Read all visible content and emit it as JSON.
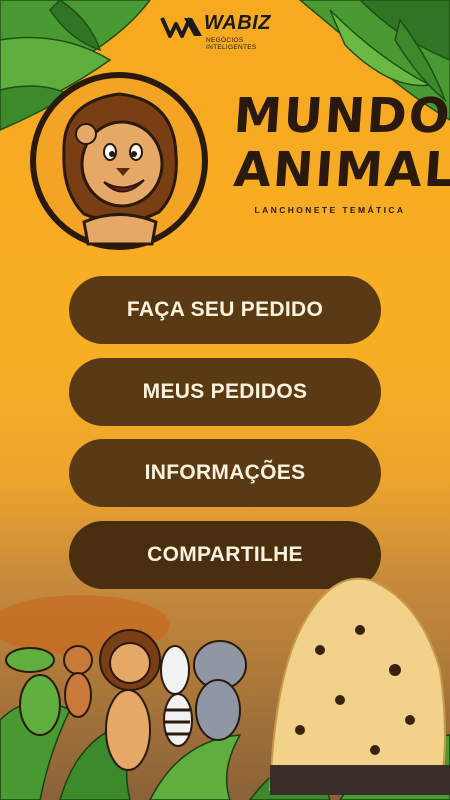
{
  "brand": {
    "name": "WABIZ",
    "tagline": "NEGÓCIOS INTELIGENTES"
  },
  "logo": {
    "title_line1": "MUNDO",
    "title_line2": "ANIMAL",
    "subtitle": "LANCHONETE TEMÁTICA",
    "mascot_icon": "lion-mascot-icon"
  },
  "menu": {
    "items": [
      {
        "label": "FAÇA SEU PEDIDO"
      },
      {
        "label": "MEUS PEDIDOS"
      },
      {
        "label": "INFORMAÇÕES"
      },
      {
        "label": "COMPARTILHE"
      }
    ]
  },
  "colors": {
    "background": "#f6ad24",
    "button": "#5a3a14",
    "button_text": "#fff3de",
    "title": "#2a1a0d",
    "leaf": "#3e8b2e"
  }
}
